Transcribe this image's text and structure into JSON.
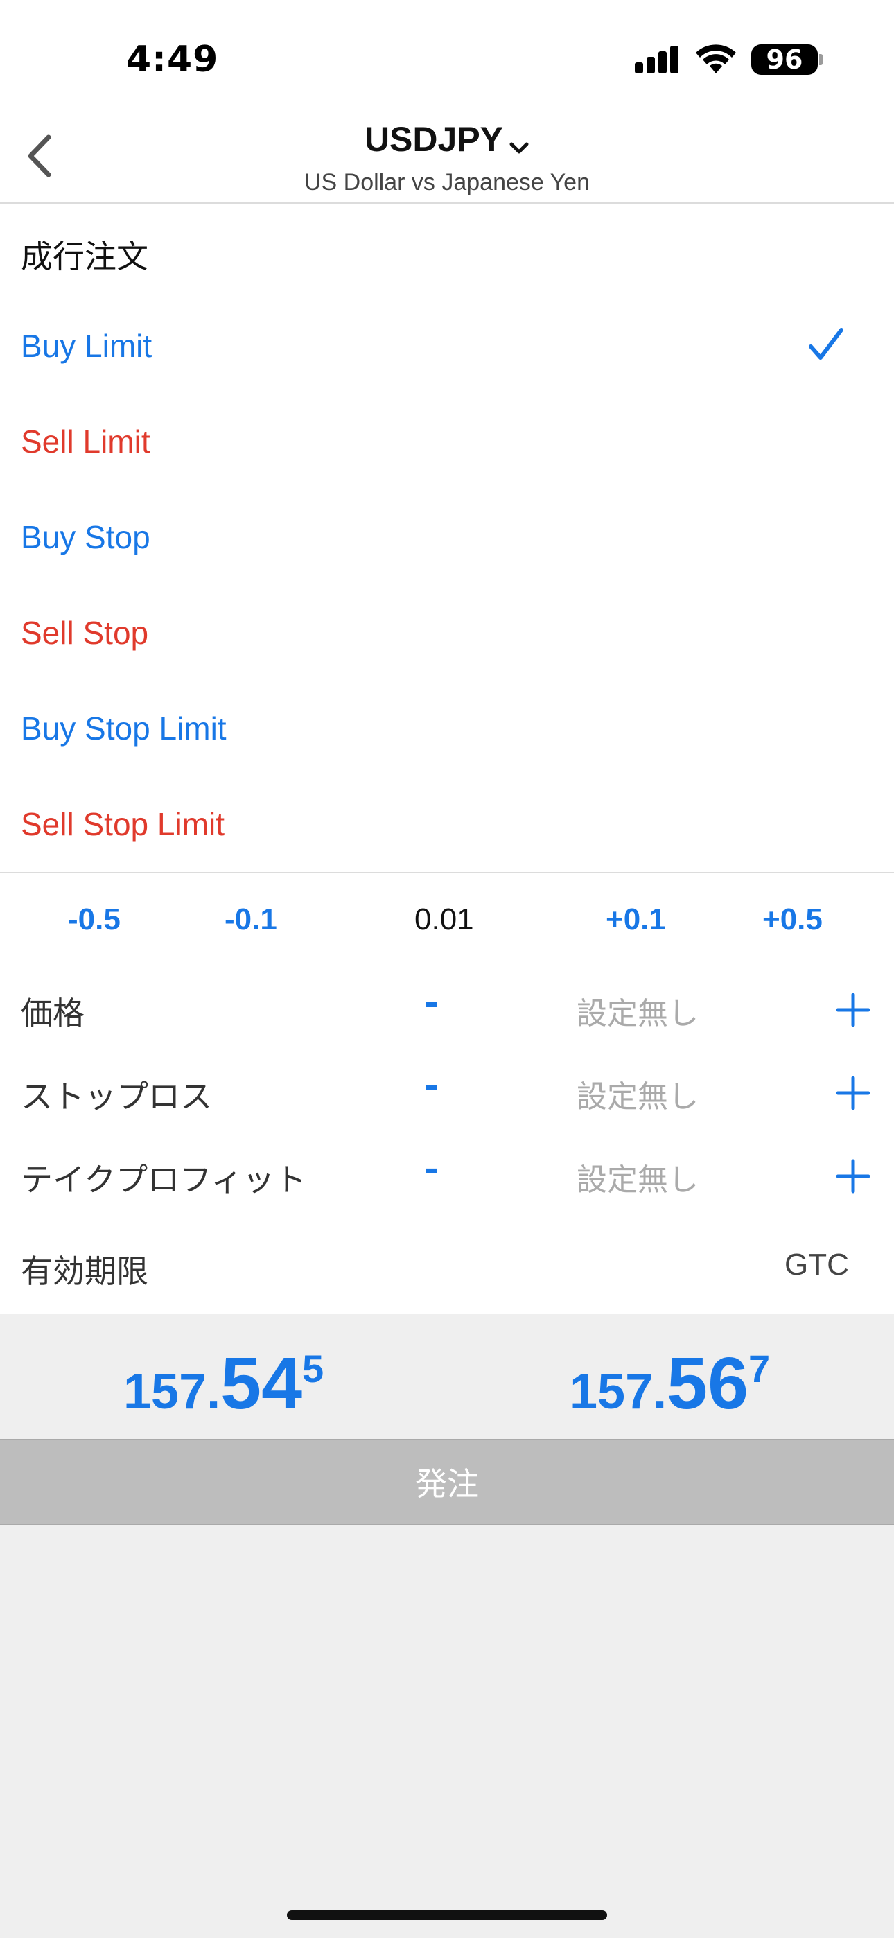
{
  "status_bar": {
    "time": "4:49",
    "battery": "96"
  },
  "header": {
    "symbol": "USDJPY",
    "subtitle": "US Dollar vs Japanese Yen"
  },
  "order_types": [
    {
      "label": "成行注文",
      "color": "#111111"
    },
    {
      "label": "Buy Limit",
      "color": "#1877e6",
      "selected": true
    },
    {
      "label": "Sell Limit",
      "color": "#e03a2c"
    },
    {
      "label": "Buy Stop",
      "color": "#1877e6"
    },
    {
      "label": "Sell Stop",
      "color": "#e03a2c"
    },
    {
      "label": "Buy Stop Limit",
      "color": "#1877e6"
    },
    {
      "label": "Sell Stop Limit",
      "color": "#e03a2c"
    }
  ],
  "volume": {
    "steps": [
      "-0.5",
      "-0.1",
      "+0.1",
      "+0.5"
    ],
    "value": "0.01"
  },
  "params": [
    {
      "label": "価格",
      "minus": "-",
      "value": "設定無し"
    },
    {
      "label": "ストップロス",
      "minus": "-",
      "value": "設定無し"
    },
    {
      "label": "テイクプロフィット",
      "minus": "-",
      "value": "設定無し"
    }
  ],
  "expiry": {
    "label": "有効期限",
    "value": "GTC"
  },
  "prices": {
    "bid": {
      "prefix": "157.",
      "big": "54",
      "sup": "5"
    },
    "ask": {
      "prefix": "157.",
      "big": "56",
      "sup": "7"
    }
  },
  "order_button": {
    "label": "発注"
  },
  "colors": {
    "accent": "#1877e6",
    "sell": "#e03a2c",
    "button_disabled": "#bdbdbd"
  }
}
